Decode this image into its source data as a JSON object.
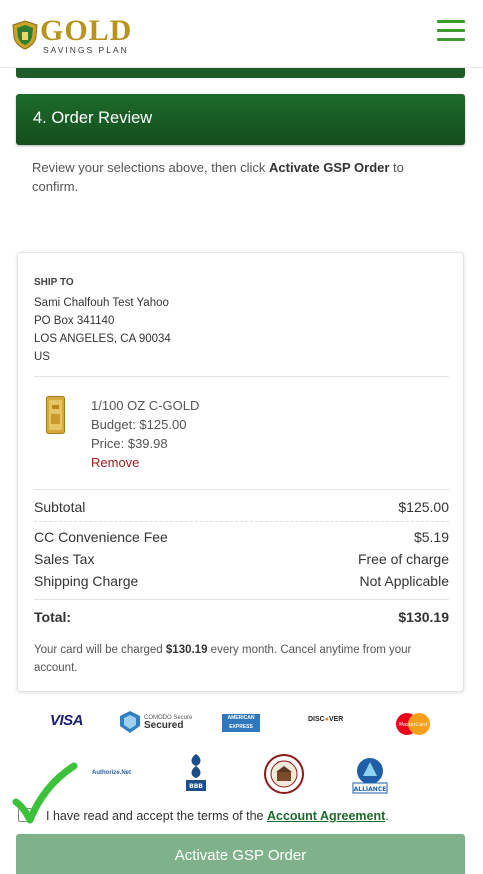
{
  "header": {
    "logo_main": "GOLD",
    "logo_sub": "SAVINGS PLAN"
  },
  "step4": {
    "title": "4. Order Review"
  },
  "review": {
    "text_before": "Review your selections above, then click ",
    "text_bold": "Activate GSP Order",
    "text_after": " to confirm."
  },
  "ship_to": {
    "label": "SHIP TO",
    "name": "Sami Chalfouh Test Yahoo",
    "line1": "PO Box 341140",
    "line2": "LOS ANGELES, CA 90034",
    "country": "US"
  },
  "product": {
    "name": "1/100 OZ C-GOLD",
    "budget": "Budget: $125.00",
    "price": "Price: $39.98",
    "remove": "Remove"
  },
  "totals": {
    "subtotal_label": "Subtotal",
    "subtotal_value": "$125.00",
    "fee_label": "CC Convenience Fee",
    "fee_value": "$5.19",
    "tax_label": "Sales Tax",
    "tax_value": "Free of charge",
    "shipping_label": "Shipping Charge",
    "shipping_value": "Not Applicable",
    "total_label": "Total:",
    "total_value": "$130.19"
  },
  "charge_note": {
    "before": "Your card will be charged ",
    "amount": "$130.19",
    "after": " every month. Cancel anytime from your account."
  },
  "badges": {
    "visa": "VISA",
    "comodo_small": "COMODO Secure",
    "comodo_big": "Secured",
    "amex": "AMERICAN EXPRESS",
    "discover_a": "DISC",
    "discover_b": "VER",
    "mastercard": "MasterCard",
    "authnet": "Authorize.Net",
    "bbb": "BBB",
    "alliance": "ALLIANCE"
  },
  "agreement": {
    "text": "I have read and accept the terms of the ",
    "link": "Account Agreement",
    "end": "."
  },
  "activate_button": "Activate GSP Order",
  "colors": {
    "brand_green": "#1d6a2a",
    "gold": "#b8941e",
    "button_green": "#7fb28a",
    "remove_red": "#9b1c1c"
  }
}
